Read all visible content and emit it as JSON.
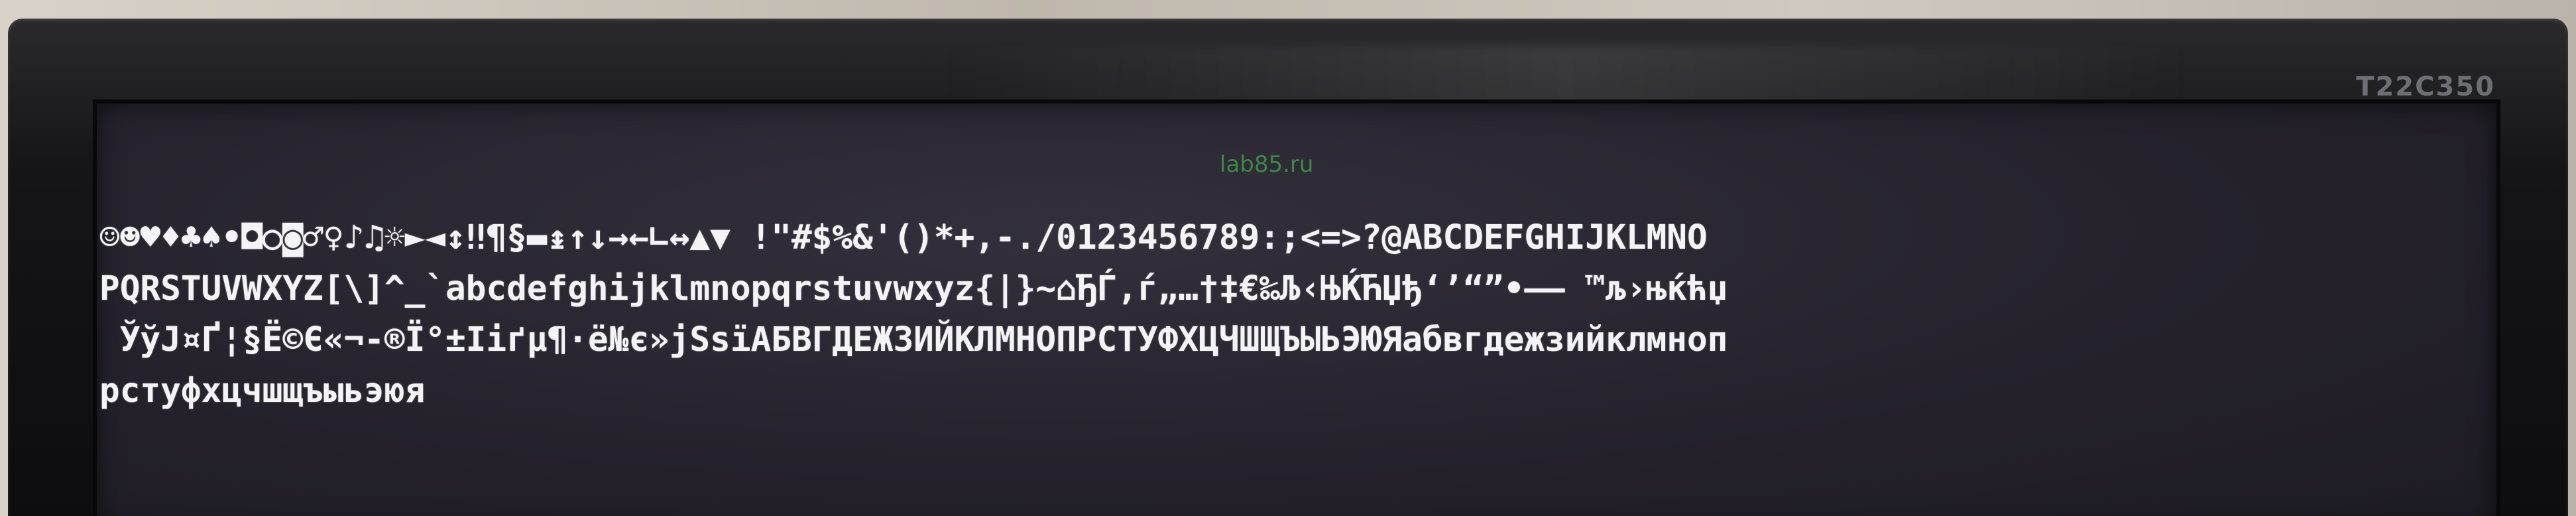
{
  "bezel": {
    "model": "T22C350"
  },
  "screen": {
    "watermark": "lab85.ru",
    "lines": [
      "☺☻♥♦♣♠•◘○◙♂♀♪♫☼►◄↕‼¶§▬↨↑↓→←∟↔▲▼ !\"#$%&'()*+,-./0123456789:;<=>?@ABCDEFGHIJKLMNO",
      "PQRSTUVWXYZ[\\]^_`abcdefghijklmnopqrstuvwxyz{|}~⌂ЂЃ‚ѓ„…†‡€‰Љ‹ЊЌЋЏђ‘’“”•–— ™љ›њќћџ",
      " ЎўЈ¤Ґ¦§Ё©Є«¬-®Ї°±Ііґµ¶·ё№є»јЅѕїАБВГДЕЖЗИЙКЛМНОПРСТУФХЦЧШЩЪЫЬЭЮЯабвгдежзийклмноп",
      "рстуфхцчшщъыьэюя"
    ]
  }
}
